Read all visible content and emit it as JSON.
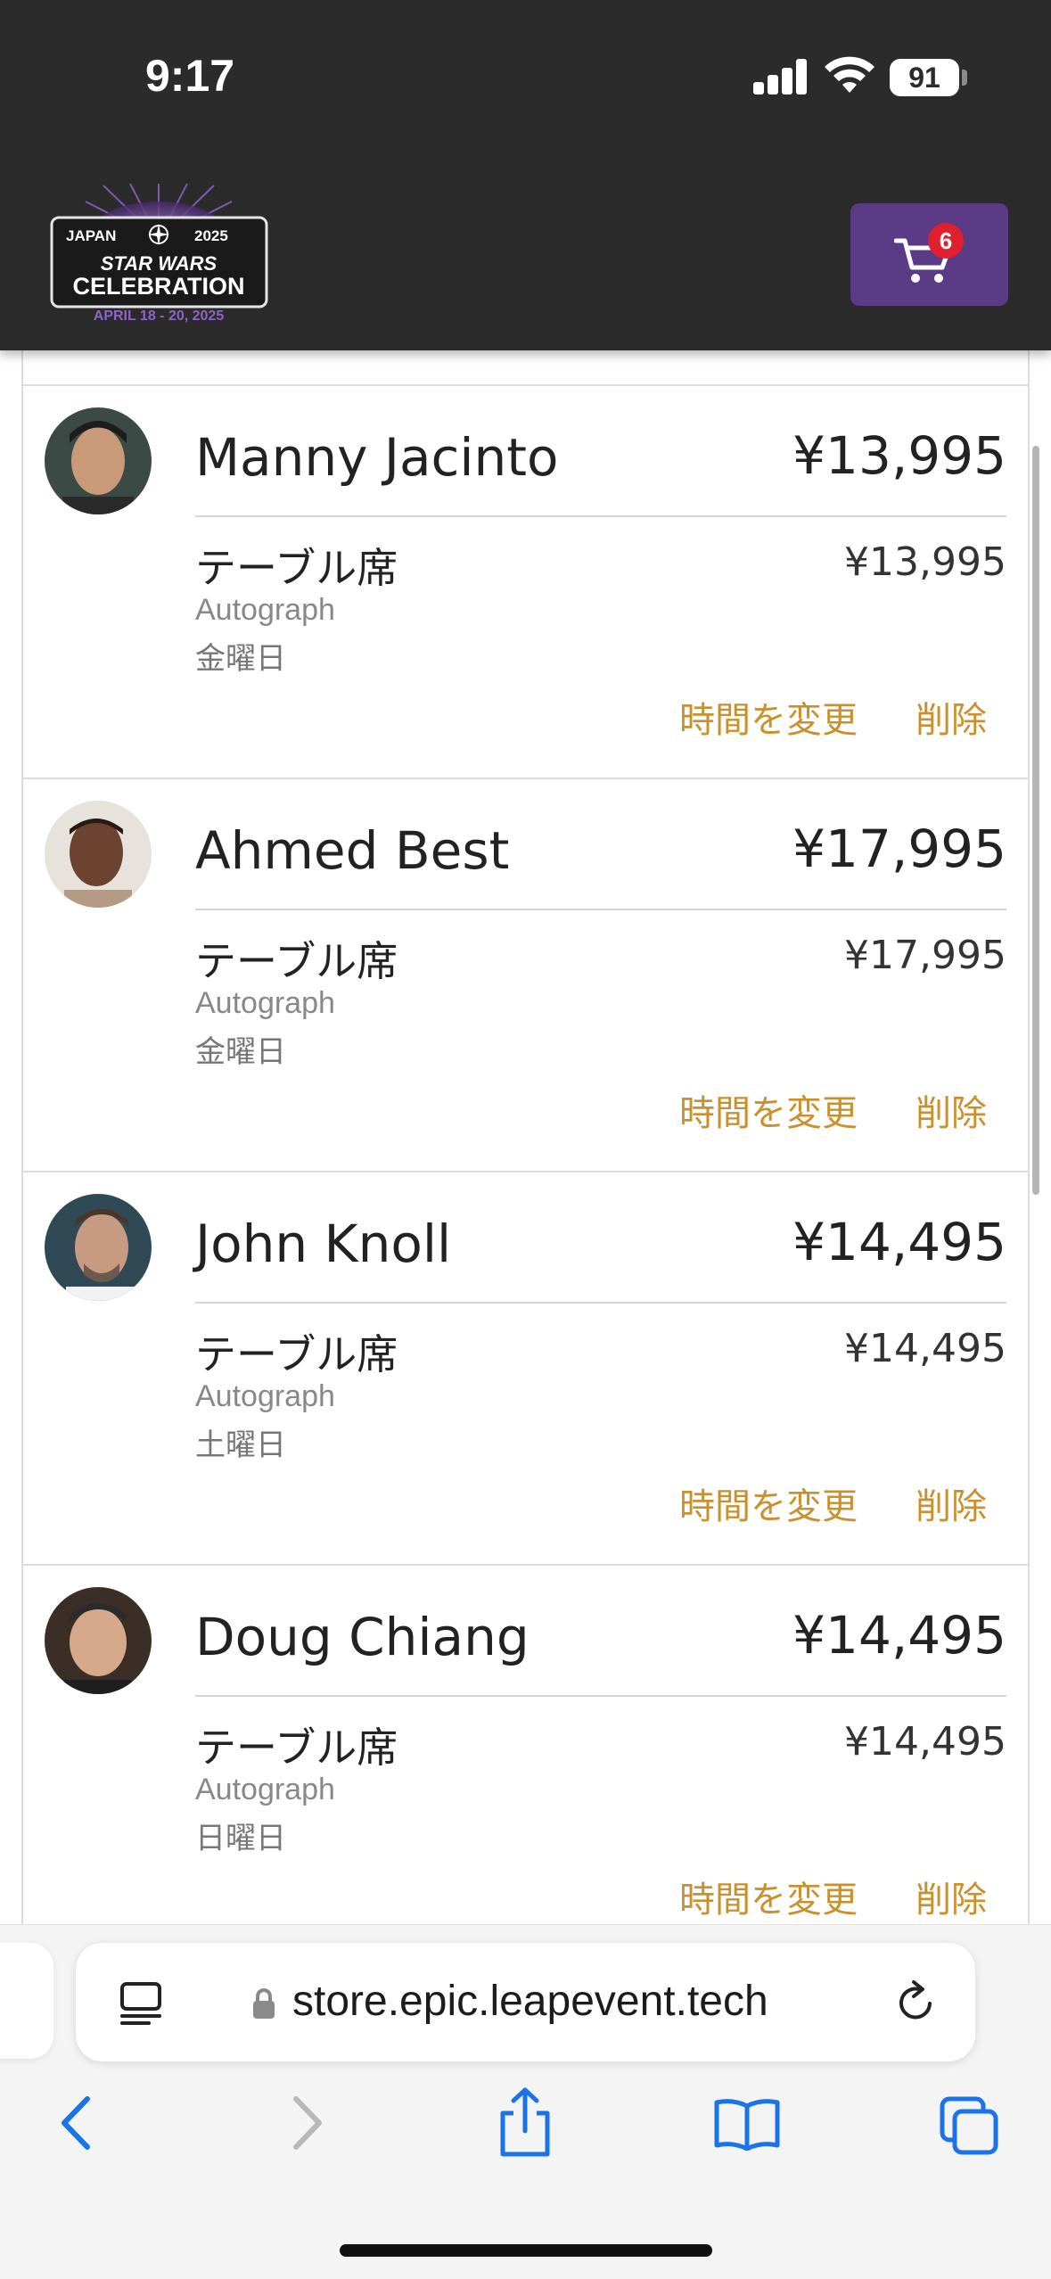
{
  "status_bar": {
    "time": "9:17",
    "battery": "91"
  },
  "header": {
    "logo_text": [
      "JAPAN",
      "2025",
      "STAR WARS",
      "CELEBRATION",
      "APRIL 18 - 20, 2025"
    ],
    "cart_count": "6",
    "colors": {
      "header_bg": "#2b2b2b",
      "cart_bg": "#5b3a86",
      "badge": "#e0202f"
    }
  },
  "cart_items": [
    {
      "name": "Manny Jacinto",
      "total": "¥13,995",
      "type": "テーブル席",
      "price": "¥13,995",
      "category": "Autograph",
      "day": "金曜日",
      "change_label": "時間を変更",
      "delete_label": "削除"
    },
    {
      "name": "Ahmed Best",
      "total": "¥17,995",
      "type": "テーブル席",
      "price": "¥17,995",
      "category": "Autograph",
      "day": "金曜日",
      "change_label": "時間を変更",
      "delete_label": "削除"
    },
    {
      "name": "John Knoll",
      "total": "¥14,495",
      "type": "テーブル席",
      "price": "¥14,495",
      "category": "Autograph",
      "day": "土曜日",
      "change_label": "時間を変更",
      "delete_label": "削除"
    },
    {
      "name": "Doug Chiang",
      "total": "¥14,495",
      "type": "テーブル席",
      "price": "¥14,495",
      "category": "Autograph",
      "day": "日曜日",
      "change_label": "時間を変更",
      "delete_label": "削除"
    }
  ],
  "browser": {
    "url": "store.epic.leapevent.tech",
    "icons": [
      "reader-icon",
      "lock-icon",
      "reload-icon",
      "back-icon",
      "forward-icon",
      "share-icon",
      "bookmarks-icon",
      "tabs-icon"
    ]
  },
  "accent_color": "#c9912e"
}
